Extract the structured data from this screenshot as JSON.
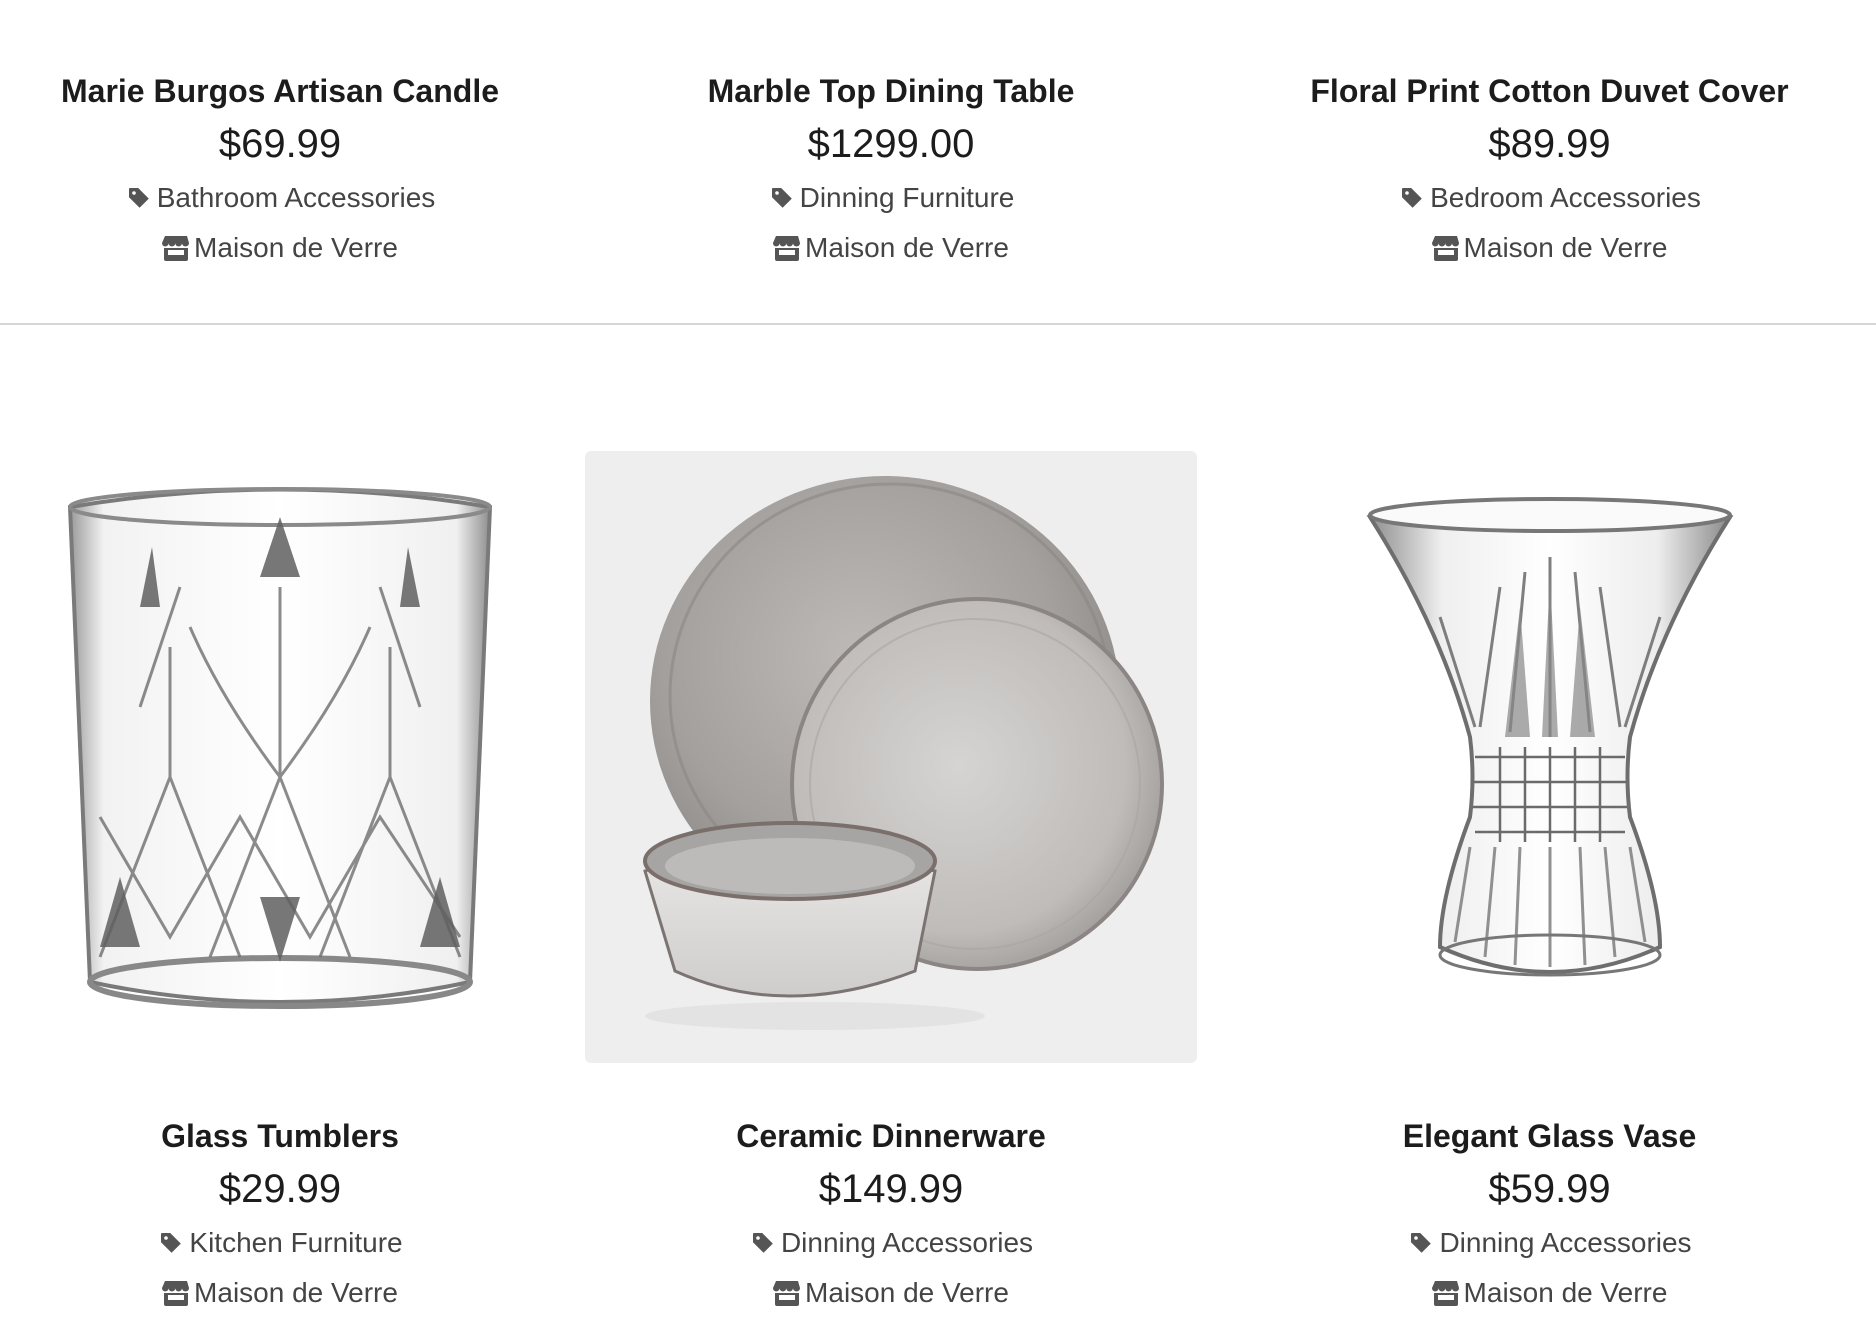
{
  "products": [
    {
      "title": "Marie Burgos Artisan Candle",
      "price": "$69.99",
      "category": "Bathroom Accessories",
      "store": "Maison de Verre",
      "image": null
    },
    {
      "title": "Marble Top Dining Table",
      "price": "$1299.00",
      "category": "Dinning Furniture",
      "store": "Maison de Verre",
      "image": null
    },
    {
      "title": "Floral Print Cotton Duvet Cover",
      "price": "$89.99",
      "category": "Bedroom Accessories",
      "store": "Maison de Verre",
      "image": null
    },
    {
      "title": "Glass Tumblers",
      "price": "$29.99",
      "category": "Kitchen Furniture",
      "store": "Maison de Verre",
      "image": "glass-tumbler"
    },
    {
      "title": "Ceramic Dinnerware",
      "price": "$149.99",
      "category": "Dinning Accessories",
      "store": "Maison de Verre",
      "image": "ceramic-dinnerware"
    },
    {
      "title": "Elegant Glass Vase",
      "price": "$59.99",
      "category": "Dinning Accessories",
      "store": "Maison de Verre",
      "image": "glass-vase"
    }
  ],
  "icons": {
    "category": "tag-icon",
    "store": "store-icon"
  },
  "colors": {
    "text": "#1c1c1c",
    "meta_text": "#444444",
    "icon": "#555555",
    "divider": "#d6d6d6"
  }
}
